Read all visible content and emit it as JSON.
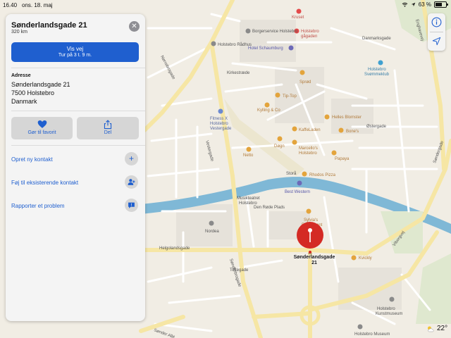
{
  "status_bar": {
    "time": "16.40",
    "date": "ons. 18. maj",
    "battery": "63 %",
    "battery_level": 0.63
  },
  "place": {
    "title": "Sønderlandsgade 21",
    "distance": "320 km",
    "close_icon": "close-icon",
    "route_button": {
      "label": "Vis vej",
      "sublabel": "Tur på 3 t. 9 m."
    },
    "address_label": "Adresse",
    "address_lines": [
      "Sønderlandsgade 21",
      "7500 Holstebro",
      "Danmark"
    ],
    "favorite_label": "Gør til favorit",
    "share_label": "Del",
    "actions": [
      "Opret ny kontakt",
      "Føj til eksisterende kontakt",
      "Rapporter et problem"
    ]
  },
  "map": {
    "pin_label": [
      "Sønderlandsgade",
      "21"
    ],
    "weather": "22°",
    "pois": [
      "Kruset",
      "Holstebro gågaden",
      "Borgerservice Holstebro",
      "Holstebro Rådhus",
      "Hotel Schaumburg",
      "Kirkestræde",
      "Sprød",
      "Tip-Top",
      "Kylling & Co",
      "Fitness X Holstebro Vestergade",
      "Helles Blomster",
      "Kaffeladen",
      "Bone's",
      "Netto",
      "Døgn",
      "Marcello's Holstebro",
      "Papaya",
      "Holstebro Svømmeklub",
      "Rhodos Pizza",
      "Best Western",
      "Musikteatret Holstebro",
      "Den Røde Plads",
      "Sylvia's Restaurant",
      "Nordea",
      "Kvickly",
      "Holstebro Kunstmuseum",
      "Holstebro Museum"
    ],
    "streets": [
      "Nørrebrogade",
      "Enghavevej",
      "Danmarksgade",
      "Helgolandsgade",
      "Sønderbrogade",
      "Søndergade",
      "Skolegade",
      "Vestergade",
      "Østergade",
      "Storå",
      "Sønderlandsgade",
      "Toftegade",
      "Sønder Allé",
      "Viborgvej",
      "Grønnegade"
    ]
  }
}
